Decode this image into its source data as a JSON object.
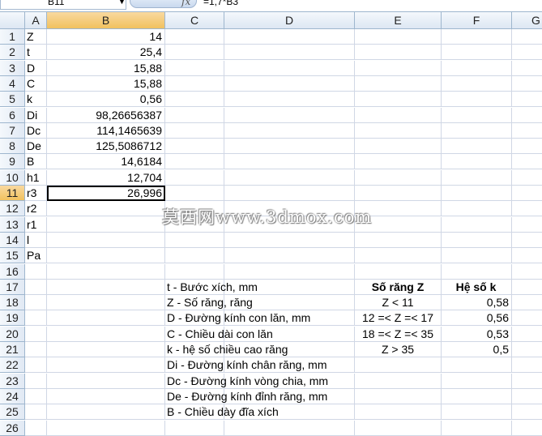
{
  "formula_bar": {
    "name_box": "B11",
    "fx": "fx",
    "formula": "=1,7*B3"
  },
  "columns": [
    "A",
    "B",
    "C",
    "D",
    "E",
    "F",
    "G"
  ],
  "rows": [
    {
      "n": "1",
      "A": "Z",
      "B": "14"
    },
    {
      "n": "2",
      "A": "t",
      "B": "25,4"
    },
    {
      "n": "3",
      "A": "D",
      "B": "15,88"
    },
    {
      "n": "4",
      "A": "C",
      "B": "15,88"
    },
    {
      "n": "5",
      "A": "k",
      "B": "0,56"
    },
    {
      "n": "6",
      "A": "Di",
      "B": "98,26656387"
    },
    {
      "n": "7",
      "A": "Dc",
      "B": "114,1465639"
    },
    {
      "n": "8",
      "A": "De",
      "B": "125,5086712"
    },
    {
      "n": "9",
      "A": "B",
      "B": "14,6184"
    },
    {
      "n": "10",
      "A": "h1",
      "B": "12,704"
    },
    {
      "n": "11",
      "A": "r3",
      "B": "26,996"
    },
    {
      "n": "12",
      "A": "r2",
      "B": ""
    },
    {
      "n": "13",
      "A": "r1",
      "B": ""
    },
    {
      "n": "14",
      "A": "l",
      "B": ""
    },
    {
      "n": "15",
      "A": "Pa",
      "B": ""
    },
    {
      "n": "16"
    },
    {
      "n": "17",
      "C": "t - Bước xích, mm",
      "E": "Số răng Z",
      "F": "Hệ số k"
    },
    {
      "n": "18",
      "C": "Z - Số răng, răng",
      "E": "Z < 11",
      "F": "0,58"
    },
    {
      "n": "19",
      "C": "D - Đường kính con lăn, mm",
      "E": "12 =< Z =< 17",
      "F": "0,56"
    },
    {
      "n": "20",
      "C": "C - Chiều dài con lăn",
      "E": "18 =< Z =< 35",
      "F": "0,53"
    },
    {
      "n": "21",
      "C": "k - hệ số chiều cao răng",
      "E": "Z > 35",
      "F": "0,5"
    },
    {
      "n": "22",
      "C": "Di - Đường kính chân răng, mm"
    },
    {
      "n": "23",
      "C": "Dc - Đường kính vòng chia, mm"
    },
    {
      "n": "24",
      "C": "De - Đường kính đỉnh răng, mm"
    },
    {
      "n": "25",
      "C": "B - Chiều dày đĩa xích"
    },
    {
      "n": "26"
    }
  ],
  "watermark": "莫西网www.3dmox.com"
}
